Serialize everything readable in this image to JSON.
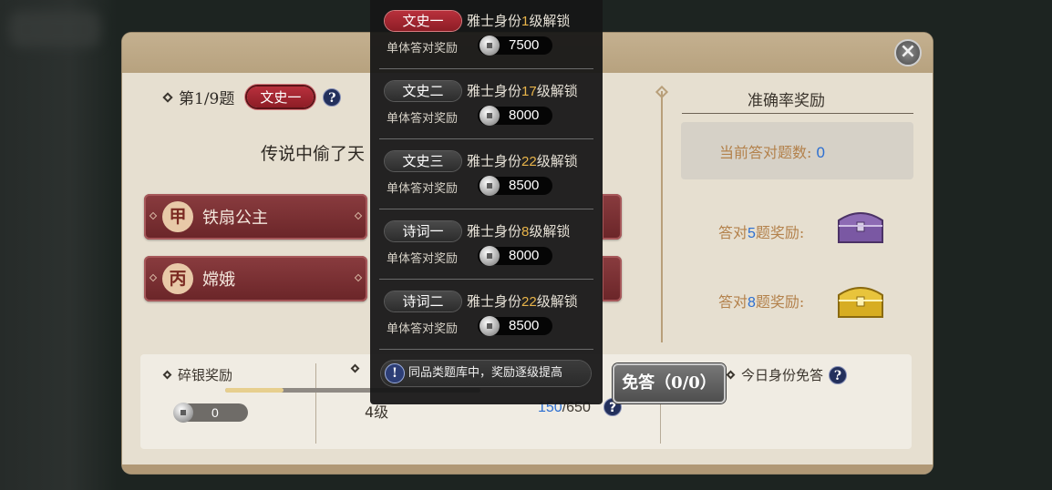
{
  "colors": {
    "accent_red": "#8d1d26",
    "gold": "#e8b44a",
    "blue": "#2c6fd1",
    "reward_orange": "#b3814b"
  },
  "question": {
    "index_label": "第1/9题",
    "category_tag": "文史一",
    "help_icon": "?",
    "text": "传说中偷了天",
    "answers": [
      {
        "badge": "甲",
        "label": "铁扇公主"
      },
      {
        "badge": "丙",
        "label": "嫦娥"
      }
    ]
  },
  "accuracy_reward": {
    "title": "准确率奖励",
    "current_label": "当前答对题数:",
    "current_value": "0",
    "milestones": [
      {
        "prefix": "答对",
        "count": "5",
        "suffix": "题奖励:",
        "chest": "purple-chest-icon"
      },
      {
        "prefix": "答对",
        "count": "8",
        "suffix": "题奖励:",
        "chest": "gold-chest-icon"
      }
    ]
  },
  "bottom": {
    "silver_title": "碎银奖励",
    "silver_value": "0",
    "level_label": "4级",
    "progress_current": "150",
    "progress_total": "/650",
    "progress_fraction": 0.23,
    "free_title": "今日身份免答",
    "free_button": "免答（0/0）"
  },
  "popup": {
    "rows": [
      {
        "tag": "文史一",
        "active": true,
        "unlock_prefix": "雅士身份",
        "level": "1",
        "unlock_suffix": "级解锁",
        "reward_label": "单体答对奖励",
        "reward_value": "7500"
      },
      {
        "tag": "文史二",
        "active": false,
        "unlock_prefix": "雅士身份",
        "level": "17",
        "unlock_suffix": "级解锁",
        "reward_label": "单体答对奖励",
        "reward_value": "8000"
      },
      {
        "tag": "文史三",
        "active": false,
        "unlock_prefix": "雅士身份",
        "level": "22",
        "unlock_suffix": "级解锁",
        "reward_label": "单体答对奖励",
        "reward_value": "8500"
      },
      {
        "tag": "诗词一",
        "active": false,
        "unlock_prefix": "雅士身份",
        "level": "8",
        "unlock_suffix": "级解锁",
        "reward_label": "单体答对奖励",
        "reward_value": "8000"
      },
      {
        "tag": "诗词二",
        "active": false,
        "unlock_prefix": "雅士身份",
        "level": "22",
        "unlock_suffix": "级解锁",
        "reward_label": "单体答对奖励",
        "reward_value": "8500"
      }
    ],
    "tip_icon": "!",
    "tip_text": "同品类题库中，奖励逐级提高"
  }
}
